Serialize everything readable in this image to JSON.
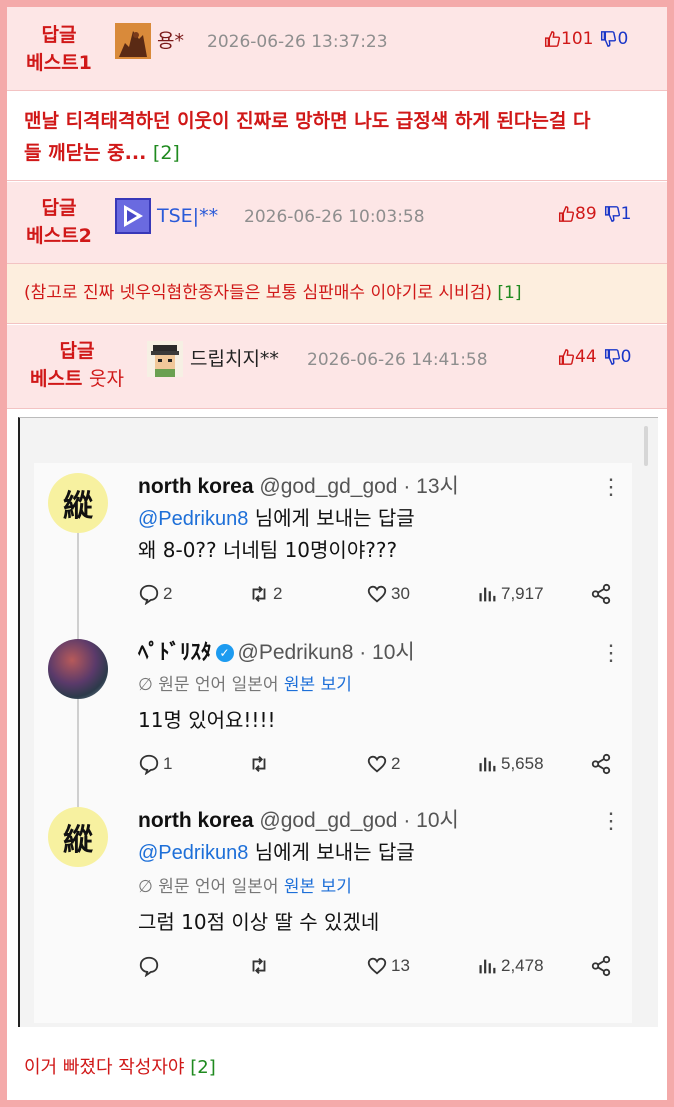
{
  "comments": [
    {
      "badge_line1": "답글",
      "badge_line2": "베스트1",
      "username": "용*",
      "date": "2026-06-26 13:37:23",
      "upvotes": "101",
      "downvotes": "0",
      "text": "맨날 티격태격하던 이웃이 진짜로 망하면 나도 급정색 하게 된다는걸 다",
      "text_line2": "들 깨닫는 중...",
      "reply_count": "[2]"
    },
    {
      "badge_line1": "답글",
      "badge_line2": "베스트2",
      "username": "TSE|**",
      "date": "2026-06-26 10:03:58",
      "upvotes": "89",
      "downvotes": "1",
      "text": "(참고로 진짜 넷우익혐한종자들은 보통 심판매수 이야기로 시비검)",
      "reply_count": "[1]"
    },
    {
      "badge_line1": "답글",
      "badge_line2_bold": "베스트",
      "badge_line2_plain": "웃자",
      "username": "드립치지**",
      "date": "2026-06-26 14:41:58",
      "upvotes": "44",
      "downvotes": "0",
      "text": "이거 빠졌다 작성자야",
      "reply_count": "[2]"
    }
  ],
  "tweets": [
    {
      "avatar_char": "縱",
      "name": "north korea",
      "handle": "@god_gd_god · 13시",
      "reply_to": "@Pedrikun8",
      "reply_suffix": "님에게 보내는 답글",
      "text": "왜 8-0?? 너네팀 10명이야???",
      "replies": "2",
      "retweets": "2",
      "likes": "30",
      "views": "7,917"
    },
    {
      "name": "ﾍﾟﾄﾞﾘｽﾀ",
      "handle": "@Pedrikun8 · 10시",
      "translate_label": "원문 언어 일본어",
      "translate_link": "원본 보기",
      "text": "11명 있어요!!!!",
      "replies": "1",
      "retweets": "",
      "likes": "2",
      "views": "5,658"
    },
    {
      "avatar_char": "縱",
      "name": "north korea",
      "handle": "@god_gd_god · 10시",
      "reply_to": "@Pedrikun8",
      "reply_suffix": "님에게 보내는 답글",
      "translate_label": "원문 언어 일본어",
      "translate_link": "원본 보기",
      "text": "그럼 10점 이상 딸 수 있겠네",
      "replies": "",
      "retweets": "",
      "likes": "13",
      "views": "2,478"
    }
  ],
  "colors": {
    "accent_red": "#d01818",
    "down_blue": "#1a36c8",
    "count_green": "#1f8a1f",
    "link_blue": "#1d6fd8"
  }
}
